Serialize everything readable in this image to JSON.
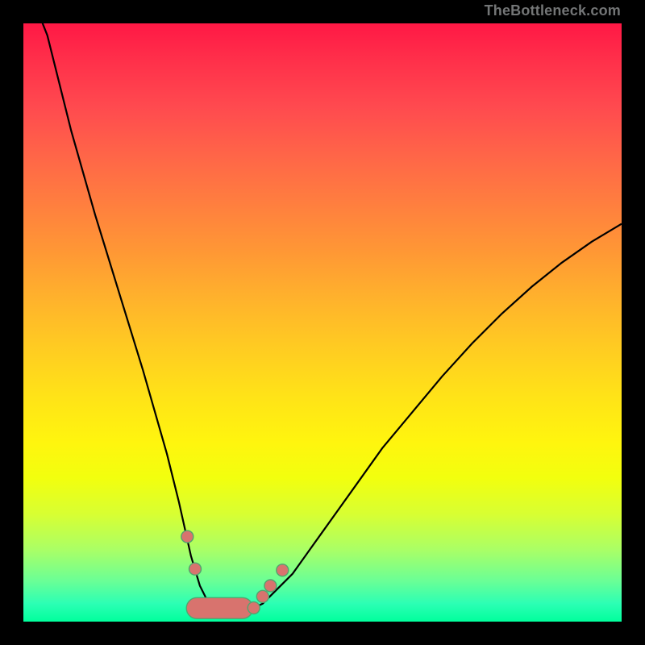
{
  "attribution": "TheBottleneck.com",
  "curve": {
    "color": "#000000",
    "width": 2.2
  },
  "markers": {
    "fill": "#d8736e",
    "stroke": "#53a46f",
    "strokeWidth": 1.4,
    "dotRadius": 7.5
  },
  "chart_data": {
    "type": "line",
    "title": "",
    "xlabel": "",
    "ylabel": "",
    "xlim": [
      0,
      100
    ],
    "ylim": [
      0,
      100
    ],
    "grid": false,
    "legend": false,
    "series": [
      {
        "name": "curve",
        "x": [
          0,
          4,
          8,
          12,
          16,
          20,
          24,
          26,
          28,
          29.5,
          31,
          32.5,
          35,
          37.5,
          40,
          45,
          50,
          55,
          60,
          65,
          70,
          75,
          80,
          85,
          90,
          95,
          100
        ],
        "y": [
          115,
          98,
          82,
          68,
          55,
          42,
          28,
          20,
          11,
          6,
          3,
          1.8,
          1.5,
          1.8,
          3,
          8,
          15,
          22,
          29,
          35,
          41,
          46.5,
          51.5,
          56,
          60,
          63.5,
          66.5
        ]
      }
    ],
    "markers_left": [
      {
        "x": 27.4,
        "y": 14.2
      },
      {
        "x": 28.7,
        "y": 8.8
      }
    ],
    "markers_right": [
      {
        "x": 38.5,
        "y": 2.3
      },
      {
        "x": 40.0,
        "y": 4.2
      },
      {
        "x": 41.3,
        "y": 6.0
      },
      {
        "x": 43.3,
        "y": 8.6
      }
    ],
    "bottom_blob": {
      "left_x": 29.0,
      "right_x": 36.6,
      "band_y_low": 0.9,
      "band_y_high": 3.6
    },
    "bottom_u": {
      "center_x": 33.0,
      "min_y": 1.4
    },
    "gradient_stops": [
      {
        "pos": 0,
        "color": "#ff1845"
      },
      {
        "pos": 14,
        "color": "#ff4a4f"
      },
      {
        "pos": 30,
        "color": "#ff7e3f"
      },
      {
        "pos": 54,
        "color": "#ffcb22"
      },
      {
        "pos": 76,
        "color": "#f2ff0e"
      },
      {
        "pos": 100,
        "color": "#00ff9c"
      }
    ]
  }
}
